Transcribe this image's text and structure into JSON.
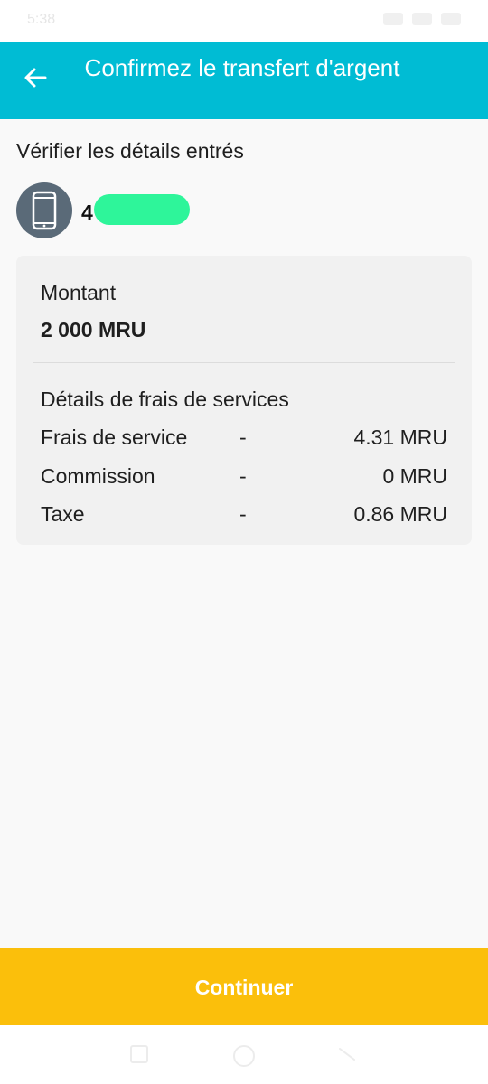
{
  "status_bar": {
    "time": "5:38"
  },
  "header": {
    "title": "Confirmez le transfert d'argent"
  },
  "main": {
    "section_title": "Vérifier les détails entrés",
    "recipient": {
      "number_prefix": "4",
      "icon": "phone-icon"
    },
    "card": {
      "amount_label": "Montant",
      "amount_value": "2 000 MRU",
      "fees_title": "Détails de frais de services",
      "fees": [
        {
          "label": "Frais de service",
          "dash": "-",
          "value": "4.31 MRU"
        },
        {
          "label": "Commission",
          "dash": "-",
          "value": "0 MRU"
        },
        {
          "label": "Taxe",
          "dash": "-",
          "value": "0.86 MRU"
        }
      ]
    }
  },
  "footer": {
    "continue_label": "Continuer"
  },
  "colors": {
    "header": "#00bcd4",
    "button": "#fbbf0b",
    "avatar": "#5a6a78",
    "card": "#f1f1f1",
    "redaction": "#2ef59a"
  }
}
